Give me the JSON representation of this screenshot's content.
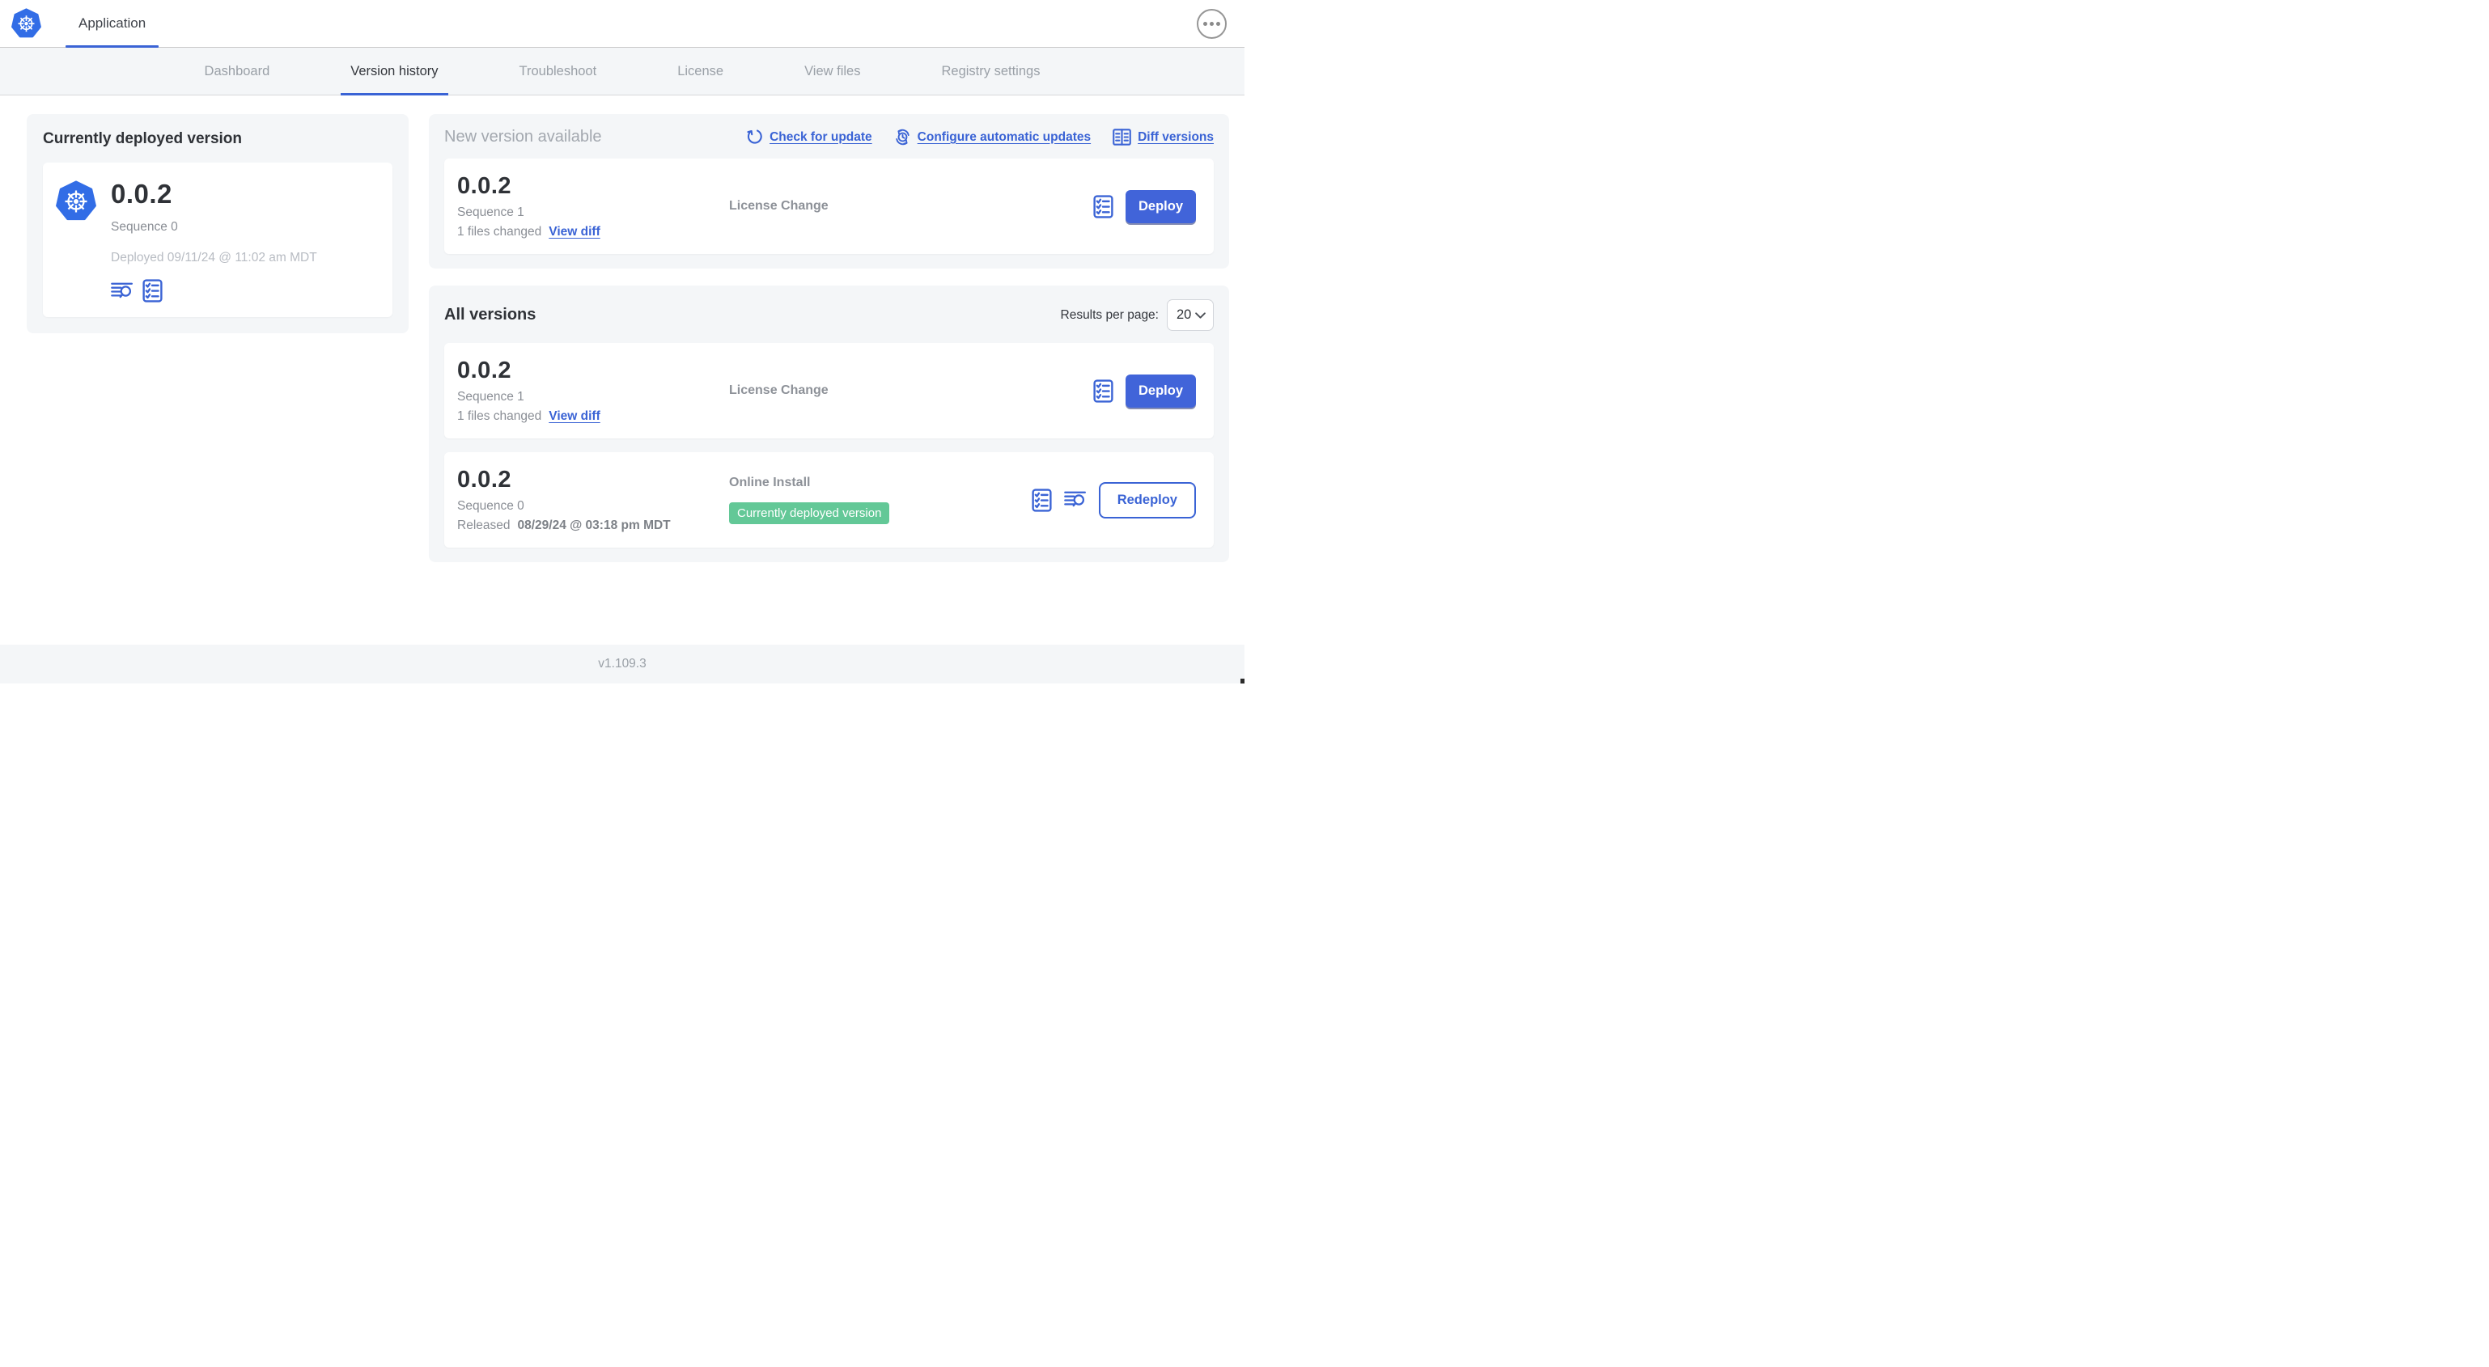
{
  "topbar": {
    "title": "Application",
    "logo_icon": "kubernetes-logo",
    "menu_icon": "ellipsis-menu-icon"
  },
  "nav": {
    "tabs": [
      {
        "label": "Dashboard",
        "active": false
      },
      {
        "label": "Version history",
        "active": true
      },
      {
        "label": "Troubleshoot",
        "active": false
      },
      {
        "label": "License",
        "active": false
      },
      {
        "label": "View files",
        "active": false
      },
      {
        "label": "Registry settings",
        "active": false
      }
    ]
  },
  "current_version_panel": {
    "title": "Currently deployed version",
    "version": "0.0.2",
    "sequence": "Sequence 0",
    "deployed": "Deployed 09/11/24 @ 11:02 am MDT",
    "icons": [
      "logs-icon",
      "checklist-icon"
    ]
  },
  "new_version_section": {
    "title": "New version available",
    "actions": [
      {
        "label": "Check for update",
        "icon": "refresh-icon"
      },
      {
        "label": "Configure automatic updates",
        "icon": "clock-refresh-icon"
      },
      {
        "label": "Diff versions",
        "icon": "diff-icon"
      }
    ],
    "card": {
      "version": "0.0.2",
      "sequence": "Sequence 1",
      "files_changed": "1 files changed",
      "view_diff": "View diff",
      "source": "License Change",
      "action": "Deploy"
    }
  },
  "all_versions_section": {
    "title": "All versions",
    "results_per_page": {
      "label": "Results per page:",
      "value": "20"
    },
    "rows": [
      {
        "version": "0.0.2",
        "sequence": "Sequence 1",
        "files_changed": "1 files changed",
        "view_diff": "View diff",
        "source": "License Change",
        "action": "Deploy"
      },
      {
        "version": "0.0.2",
        "sequence": "Sequence 0",
        "released_prefix": "Released",
        "released_date": "08/29/24 @ 03:18 pm MDT",
        "source": "Online Install",
        "badge": "Currently deployed version",
        "action": "Redeploy"
      }
    ]
  },
  "footer": {
    "app_version": "v1.109.3"
  },
  "colors": {
    "accent_blue": "#3a63d5",
    "button_blue": "#4164d9",
    "kubernetes_blue": "#326de6",
    "badge_green": "#63c897",
    "panel_bg": "#f4f6f8"
  }
}
